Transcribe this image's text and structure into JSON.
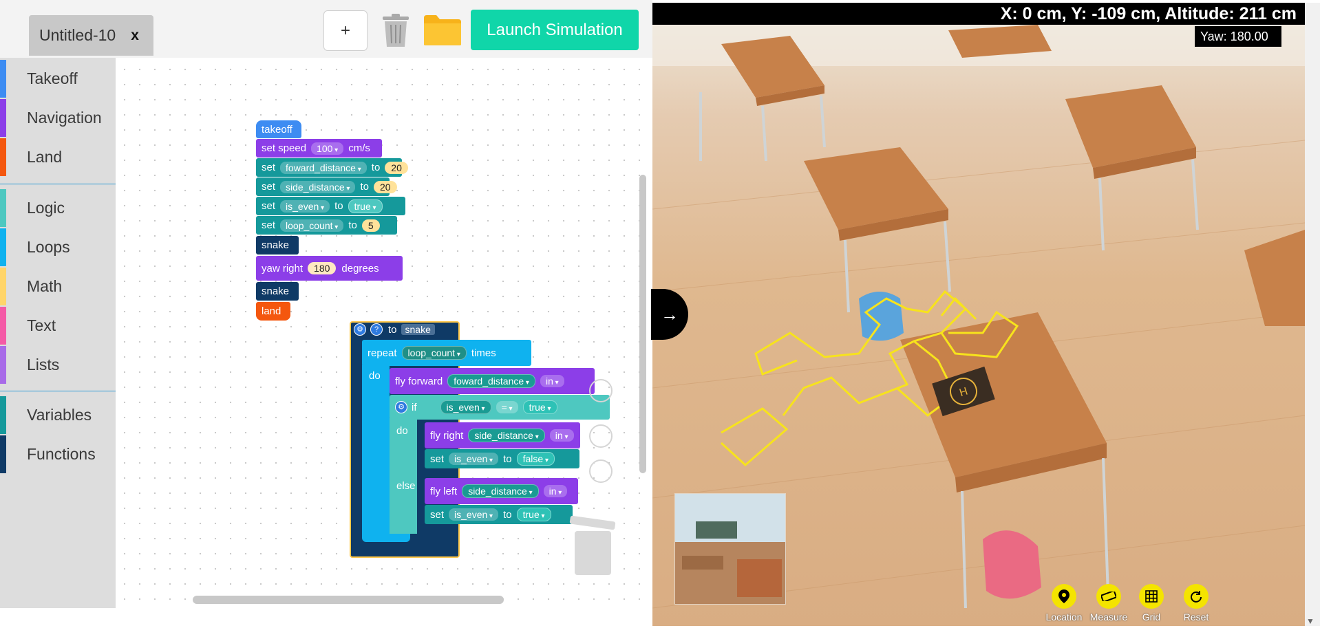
{
  "tab": {
    "name": "Untitled-10",
    "close_label": "x"
  },
  "toolbar": {
    "add_label": "+",
    "trash_icon": "trash-icon",
    "folder_icon": "folder-icon",
    "launch_label": "Launch Simulation"
  },
  "sidebar": {
    "items": [
      {
        "label": "Takeoff",
        "color": "#3d8cf2"
      },
      {
        "label": "Navigation",
        "color": "#8c3ee8"
      },
      {
        "label": "Land",
        "color": "#f4570e"
      },
      {
        "label": "Logic",
        "color": "#4ec8c0"
      },
      {
        "label": "Loops",
        "color": "#0fb2ef"
      },
      {
        "label": "Math",
        "color": "#ffd56a"
      },
      {
        "label": "Text",
        "color": "#f45aa6"
      },
      {
        "label": "Lists",
        "color": "#a86be8"
      },
      {
        "label": "Variables",
        "color": "#15999b"
      },
      {
        "label": "Functions",
        "color": "#0f3a66"
      }
    ]
  },
  "blocks": {
    "takeoff": "takeoff",
    "set_speed": {
      "label": "set speed",
      "value": "100",
      "unit": "cm/s"
    },
    "set_forward": {
      "set": "set",
      "var": "foward_distance",
      "to": "to",
      "value": "20"
    },
    "set_side": {
      "set": "set",
      "var": "side_distance",
      "to": "to",
      "value": "20"
    },
    "set_even": {
      "set": "set",
      "var": "is_even",
      "to": "to",
      "value": "true"
    },
    "set_loop": {
      "set": "set",
      "var": "loop_count",
      "to": "to",
      "value": "5"
    },
    "snake1": "snake",
    "yaw": {
      "label": "yaw right",
      "value": "180",
      "unit": "degrees"
    },
    "snake2": "snake",
    "land": "land",
    "fn": {
      "gear": "⚙",
      "q": "?",
      "to": "to",
      "name": "snake",
      "repeat": "repeat",
      "repeat_var": "loop_count",
      "times": "times",
      "do": "do",
      "fly_forward": "fly forward",
      "fly_forward_var": "foward_distance",
      "in": "in",
      "if": "if",
      "if_var": "is_even",
      "eq": "=",
      "if_val": "true",
      "do2": "do",
      "fly_right": "fly right",
      "fly_right_var": "side_distance",
      "set": "set",
      "set_var": "is_even",
      "to2": "to",
      "set_false": "false",
      "else": "else",
      "fly_left": "fly left",
      "fly_left_var": "side_distance",
      "set_true": "true"
    }
  },
  "simulation": {
    "coords": "X: 0 cm, Y: -109 cm, Altitude: 211 cm",
    "yaw": "Yaw: 180.00",
    "arrow": "→",
    "tools": [
      {
        "label": "Location",
        "icon": "location-pin-icon"
      },
      {
        "label": "Measure",
        "icon": "ruler-icon"
      },
      {
        "label": "Grid",
        "icon": "grid-icon"
      },
      {
        "label": "Reset",
        "icon": "reset-icon"
      }
    ],
    "path_color": "#f7e31c",
    "pad_letter": "H"
  }
}
